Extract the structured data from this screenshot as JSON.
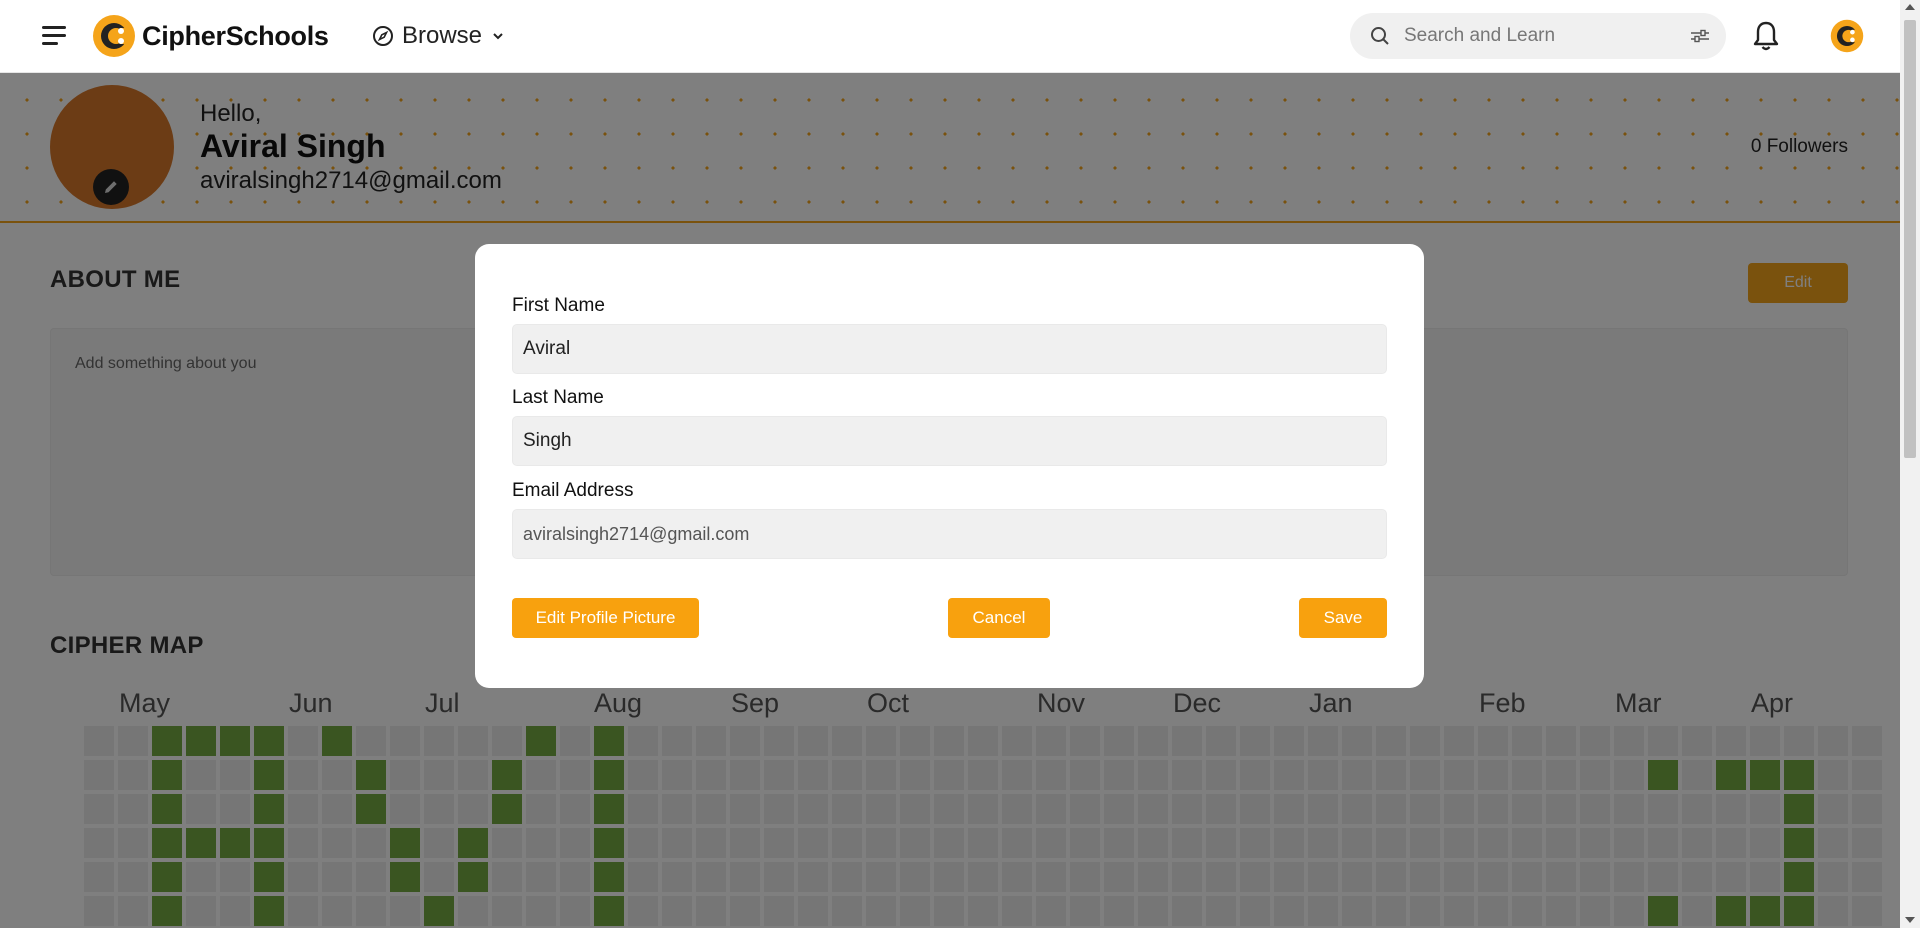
{
  "navbar": {
    "logo_text": "CipherSchools",
    "browse_label": "Browse",
    "search_placeholder": "Search and Learn"
  },
  "profile": {
    "greeting": "Hello,",
    "name": "Aviral Singh",
    "email": "aviralsingh2714@gmail.com",
    "followers": "0 Followers"
  },
  "about": {
    "title": "ABOUT ME",
    "edit_label": "Edit",
    "placeholder": "Add something about you"
  },
  "cipher_map": {
    "title": "CIPHER MAP",
    "months": [
      "May",
      "Jun",
      "Jul",
      "Aug",
      "Sep",
      "Oct",
      "Nov",
      "Dec",
      "Jan",
      "Feb",
      "Mar",
      "Apr"
    ]
  },
  "modal": {
    "first_name_label": "First Name",
    "first_name_value": "Aviral",
    "last_name_label": "Last Name",
    "last_name_value": "Singh",
    "email_label": "Email Address",
    "email_value": "aviralsingh2714@gmail.com",
    "edit_picture_label": "Edit Profile Picture",
    "cancel_label": "Cancel",
    "save_label": "Save"
  },
  "colors": {
    "accent": "#f8a10e",
    "map_active": "#74ab42",
    "avatar": "#d8782a"
  }
}
